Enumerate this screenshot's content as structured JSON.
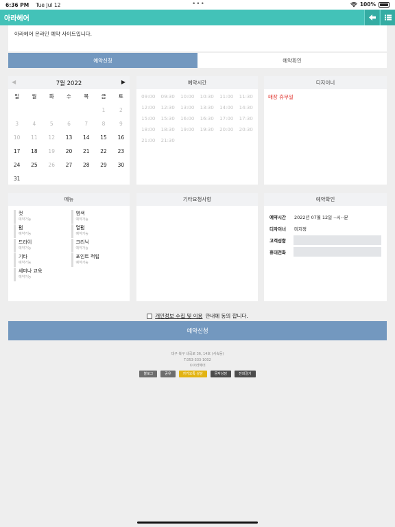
{
  "status": {
    "time": "6:36 PM",
    "date": "Tue Jul 12",
    "battery": "100%"
  },
  "app": {
    "title": "아라헤어"
  },
  "intro": {
    "text": "아라헤어 온라인 예약 사이트입니다."
  },
  "tabs": [
    {
      "label": "예약신청"
    },
    {
      "label": "예약확인"
    }
  ],
  "calendar": {
    "month": "7월 2022",
    "weekdays": [
      "일",
      "월",
      "화",
      "수",
      "목",
      "금",
      "토"
    ],
    "weeks": [
      [
        "",
        "",
        "",
        "",
        "",
        "1",
        "2"
      ],
      [
        "3",
        "4",
        "5",
        "6",
        "7",
        "8",
        "9"
      ],
      [
        "10",
        "11",
        "12",
        "13",
        "14",
        "15",
        "16"
      ],
      [
        "17",
        "18",
        "19",
        "20",
        "21",
        "22",
        "23"
      ],
      [
        "24",
        "25",
        "26",
        "27",
        "28",
        "29",
        "30"
      ],
      [
        "31",
        "",
        "",
        "",
        "",
        "",
        ""
      ]
    ],
    "dim_days": [
      "1",
      "2",
      "3",
      "4",
      "5",
      "6",
      "7",
      "8",
      "9",
      "10",
      "11",
      "12",
      "19",
      "26"
    ]
  },
  "time_panel": {
    "header": "예약시간",
    "slots": [
      "09:00",
      "09:30",
      "10:00",
      "10:30",
      "11:00",
      "11:30",
      "12:00",
      "12:30",
      "13:00",
      "13:30",
      "14:00",
      "14:30",
      "15:00",
      "15:30",
      "16:00",
      "16:30",
      "17:00",
      "17:30",
      "18:00",
      "18:30",
      "19:00",
      "19:30",
      "20:00",
      "20:30",
      "21:00",
      "21:30"
    ]
  },
  "designer_panel": {
    "header": "디자이너",
    "closed_text": "매장 휴무일"
  },
  "menu_panel": {
    "header": "메뉴",
    "items": [
      {
        "name": "컷",
        "sub": "예약가능"
      },
      {
        "name": "염색",
        "sub": "예약가능"
      },
      {
        "name": "펌",
        "sub": "예약가능"
      },
      {
        "name": "열펌",
        "sub": "예약가능"
      },
      {
        "name": "드라이",
        "sub": "예약가능"
      },
      {
        "name": "크리닉",
        "sub": "예약가능"
      },
      {
        "name": "기타",
        "sub": "예약가능"
      },
      {
        "name": "포인트 적립",
        "sub": "예약가능"
      },
      {
        "name": "세미나 교육",
        "sub": "예약가능"
      }
    ]
  },
  "request_panel": {
    "header": "기타요청사항"
  },
  "confirm_panel": {
    "header": "예약확인",
    "time_label": "예약시간",
    "time_value": "2022년 07월 12일 --시--분",
    "designer_label": "디자이너",
    "designer_value": "미지정",
    "name_label": "고객성함",
    "phone_label": "휴대전화"
  },
  "agree": {
    "link": "개인정보 수집 및 이용",
    "text": "안내에 동의 합니다."
  },
  "submit": {
    "label": "예약신청"
  },
  "footer": {
    "address": "대구 북구 내곡로 36, 14호 (서숙동)",
    "phone": "T.053-333-1002",
    "brand": "©아라헤어",
    "buttons": [
      "블로그",
      "공유",
      "카카오톡 상담",
      "문자상담",
      "전화걸기"
    ]
  },
  "colors": {
    "accent": "#43c2b8",
    "tab_active": "#7398bf",
    "closed": "#e0322c",
    "kakao": "#e2b312"
  }
}
